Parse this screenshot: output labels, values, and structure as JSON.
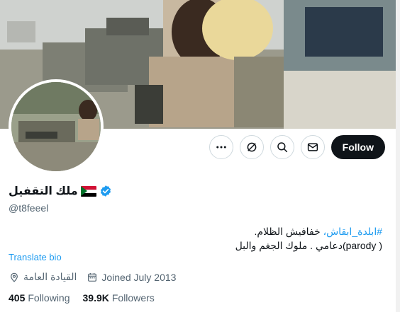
{
  "profile": {
    "display_name": "ملك التقفيل",
    "handle": "@t8feeel",
    "bio_hashtag": "#ابلدة_ابقاش،",
    "bio_line1_rest": " خفافيش الظلام.",
    "bio_line2": "( parody)دعامي . ملوك الجغم والبل",
    "translate_bio": "Translate bio",
    "location": "القيادة العامة",
    "joined": "Joined July 2013",
    "following_count": "405",
    "following_label": "Following",
    "followers_count": "39.9K",
    "followers_label": "Followers"
  },
  "actions": {
    "more_icon": "more-icon",
    "grok_icon": "grok-icon",
    "search_icon": "search-icon",
    "message_icon": "mail-icon",
    "follow_label": "Follow"
  },
  "colors": {
    "accent": "#1d9bf0",
    "primary_text": "#0f1419",
    "secondary_text": "#536471",
    "follow_bg": "#0f1419"
  }
}
